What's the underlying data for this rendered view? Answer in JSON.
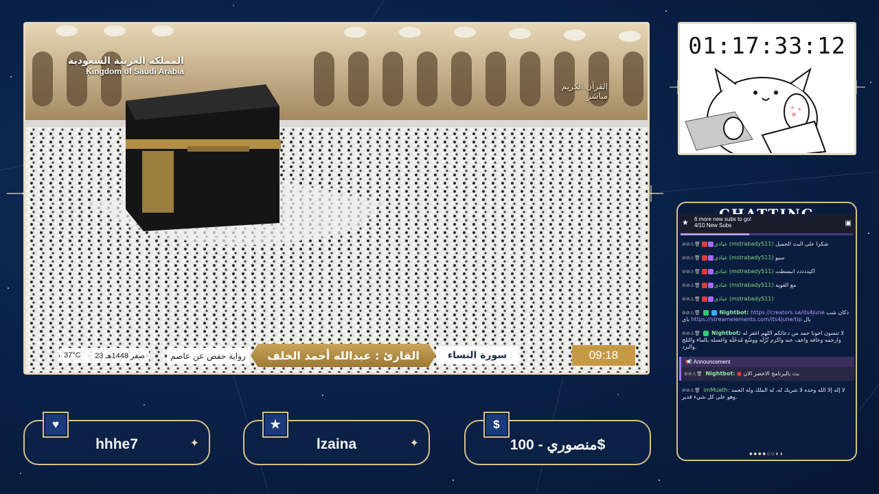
{
  "overlay": {
    "timer": "01:17:33:12",
    "chat_title": "CHATTING",
    "accent": "#d8c08a"
  },
  "video": {
    "channel_ar": "المملكة العربية السعودية",
    "channel_en": "Kingdom of Saudi Arabia",
    "quran_tag": "القرآن الكريم",
    "live_tag": "مباشر",
    "temperature": "37°C",
    "date": "23 صفر 1448هـ",
    "narration": "رواية حفص عن عاصم",
    "reader": "القارئ : عبدالله أحمد الخلف",
    "surah": "سورة النساء",
    "time": "09:18"
  },
  "sub_goal": {
    "title": "6 more new subs to go!",
    "progress_text": "4/10 New Subs",
    "progress": 0.4
  },
  "chat": {
    "messages": [
      {
        "user": "(mstrabady511)",
        "display": "عبادي",
        "text": "شكرا على البث الجميل"
      },
      {
        "user": "(mstrabady511)",
        "display": "عبادي",
        "text": "سيو"
      },
      {
        "user": "(mstrabady511)",
        "display": "عبادي",
        "text": "اكيددددد انبسطت"
      },
      {
        "user": "(mstrabady511)",
        "display": "عبادي",
        "text": "مع الغويه"
      },
      {
        "user": "(mstrabady511)",
        "display": "عبادي",
        "text": ""
      }
    ],
    "bot1": {
      "user": "Nightbot:",
      "link": "https://creators.sa/its4june",
      "pre": "دكان شب",
      "mid": "باي",
      "post": "بال",
      "link2": "https://streamelements.com/its4june/tip"
    },
    "bot2": {
      "user": "Nightbot:",
      "text": "لا تنسون اخونا حمد من دعائكم اللهم اغفر له وارحمه وعافه واعف عنه واكرم نُزُلَه ووسّع مُدخَلَه واغسله بالماء والثلج والبرد."
    },
    "announcement_label": "Announcement",
    "bot3": {
      "user": "Nightbot:",
      "text": "بث بالبرنامج الاخضر الان"
    },
    "user4": {
      "user": "imMuath:",
      "text": "لا إله إلا الله وحده لا شريك له، له الملك وله الحمد وهو على كل شيء قدير."
    }
  },
  "boxes": {
    "follower": {
      "icon": "♥",
      "value": "hhhe7"
    },
    "subscriber": {
      "icon": "★",
      "value": "lzaina"
    },
    "donation": {
      "icon": "$",
      "value": "منصوري - 100$"
    }
  }
}
